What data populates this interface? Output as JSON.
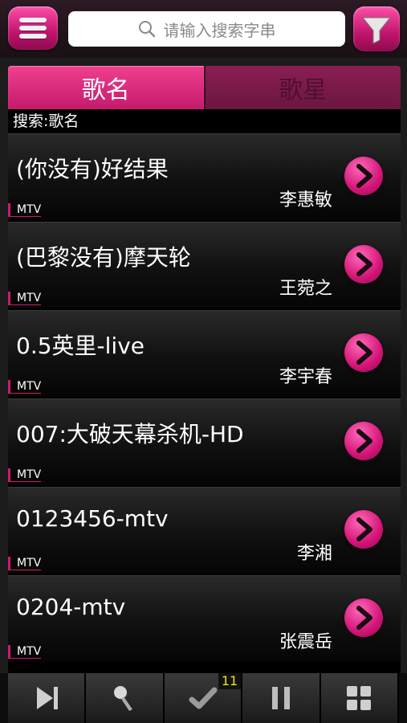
{
  "header": {
    "menu_icon": "hamburger-menu-icon",
    "search_placeholder": "请输入搜索字串",
    "filter_icon": "filter-funnel-icon"
  },
  "tabs": [
    {
      "label": "歌名",
      "active": true
    },
    {
      "label": "歌星",
      "active": false
    }
  ],
  "search_label": "搜索:歌名",
  "songs": [
    {
      "title": "(你没有)好结果",
      "artist": "李惠敏",
      "tag": "MTV"
    },
    {
      "title": "(巴黎没有)摩天轮",
      "artist": "王菀之",
      "tag": "MTV"
    },
    {
      "title": "0.5英里-live",
      "artist": "李宇春",
      "tag": "MTV"
    },
    {
      "title": "007:大破天幕杀机-HD",
      "artist": "",
      "tag": "MTV"
    },
    {
      "title": "0123456-mtv",
      "artist": "李湘",
      "tag": "MTV"
    },
    {
      "title": "0204-mtv",
      "artist": "张震岳",
      "tag": "MTV"
    }
  ],
  "toolbar": {
    "items": [
      {
        "icon": "skip-next-icon"
      },
      {
        "icon": "microphone-icon"
      },
      {
        "icon": "checkmark-icon",
        "badge": "11"
      },
      {
        "icon": "pause-icon"
      },
      {
        "icon": "grid-icon"
      }
    ]
  },
  "colors": {
    "accent": "#d01872",
    "badge": "#e8e800"
  }
}
